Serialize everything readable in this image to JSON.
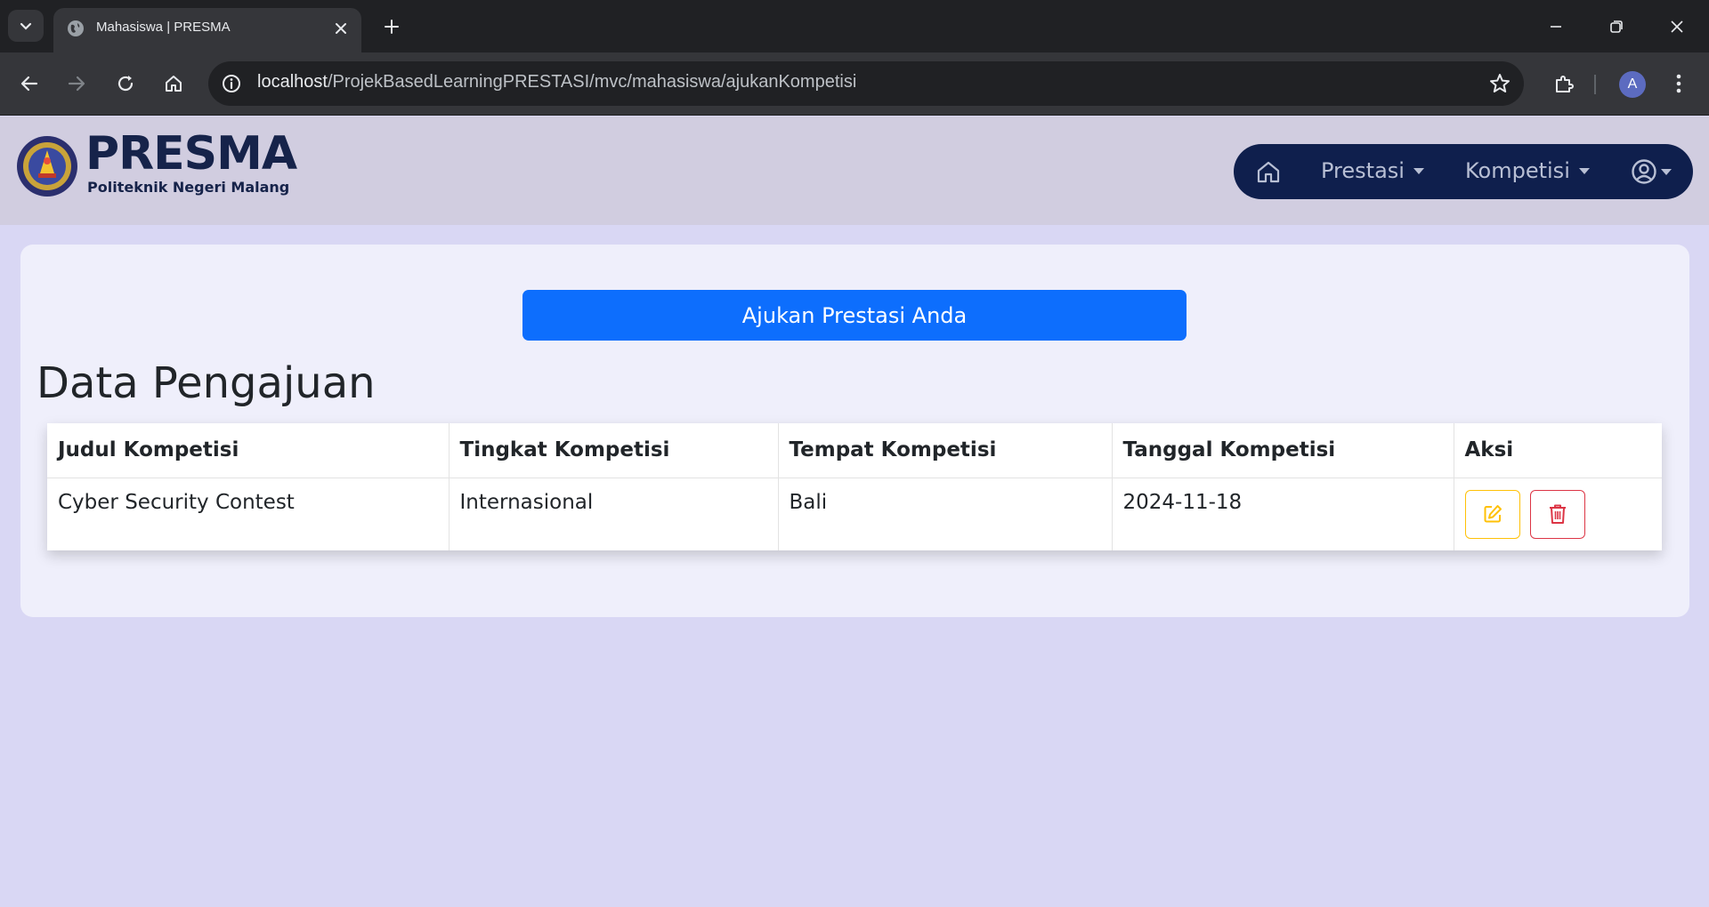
{
  "browser": {
    "tab_title": "Mahasiswa | PRESMA",
    "url_host": "localhost",
    "url_path": "/ProjekBasedLearningPRESTASI/mvc/mahasiswa/ajukanKompetisi",
    "profile_initial": "A"
  },
  "header": {
    "logo_title": "PRESMA",
    "logo_subtitle": "Politeknik Negeri Malang",
    "nav": {
      "prestasi_label": "Prestasi",
      "kompetisi_label": "Kompetisi"
    }
  },
  "main": {
    "submit_label": "Ajukan Prestasi Anda",
    "section_title": "Data Pengajuan",
    "table": {
      "columns": [
        "Judul Kompetisi",
        "Tingkat Kompetisi",
        "Tempat Kompetisi",
        "Tanggal Kompetisi",
        "Aksi"
      ],
      "rows": [
        [
          "Cyber Security Contest",
          "Internasional",
          "Bali",
          "2024-11-18"
        ]
      ]
    }
  },
  "colors": {
    "primary_button": "#0d6efd",
    "nav_pill": "#0f1f4d",
    "page_background": "#d9d7f4",
    "edit_accent": "#ffc107",
    "delete_accent": "#dc3545"
  },
  "icons": {
    "tab_search": "chevron-down-icon",
    "favicon": "globe-icon",
    "nav_home": "home-icon",
    "user": "user-circle-icon",
    "edit": "edit-icon",
    "delete": "trash-icon"
  }
}
